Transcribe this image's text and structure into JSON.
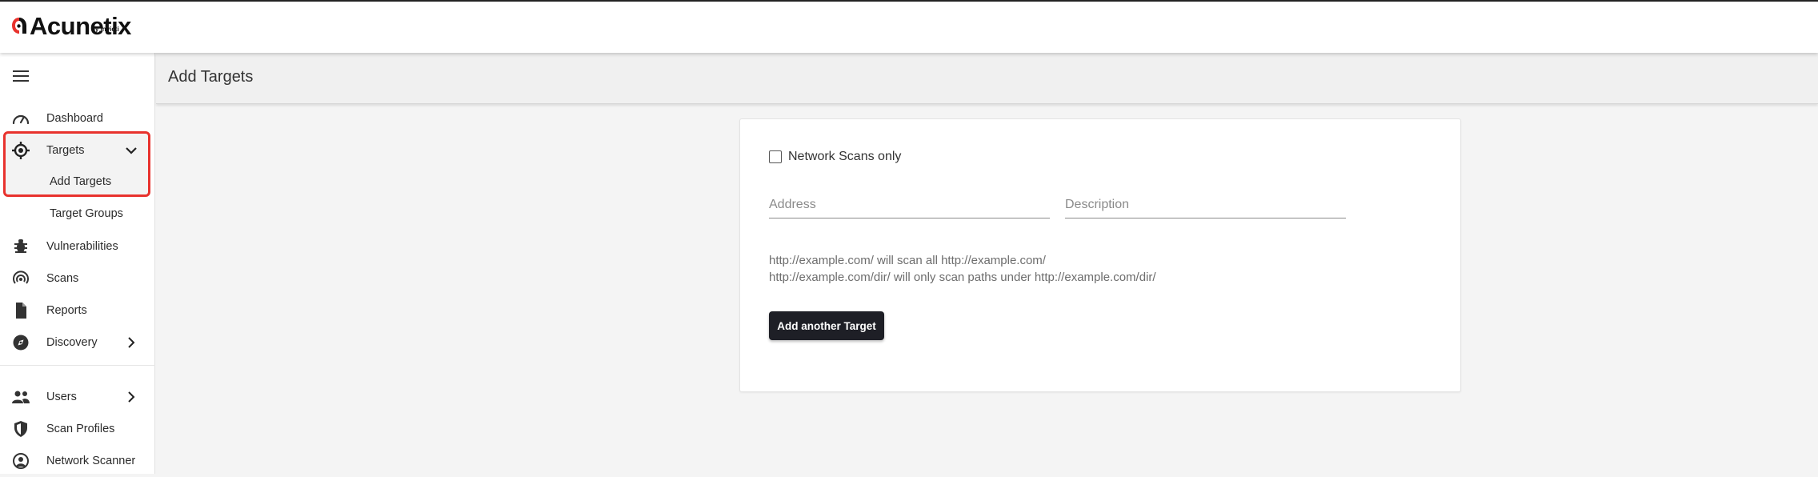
{
  "app": {
    "brand": "Acunetix",
    "brand_by": "by Invicti"
  },
  "sidebar": {
    "items": [
      {
        "label": "Dashboard",
        "icon": "dashboard-gauge-icon"
      },
      {
        "label": "Targets",
        "icon": "target-crosshair-icon",
        "expanded": true
      },
      {
        "label": "Add Targets",
        "sub": true,
        "selected": true
      },
      {
        "label": "Target Groups",
        "sub": true
      },
      {
        "label": "Vulnerabilities",
        "icon": "bug-icon"
      },
      {
        "label": "Scans",
        "icon": "radar-icon"
      },
      {
        "label": "Reports",
        "icon": "document-icon"
      },
      {
        "label": "Discovery",
        "icon": "compass-icon"
      },
      {
        "label": "Users",
        "icon": "users-icon"
      },
      {
        "label": "Scan Profiles",
        "icon": "shield-icon"
      },
      {
        "label": "Network Scanner",
        "icon": "network-scanner-icon"
      }
    ]
  },
  "page": {
    "title": "Add Targets"
  },
  "form": {
    "network_only_label": "Network Scans only",
    "network_only_checked": false,
    "address_placeholder": "Address",
    "address_value": "",
    "description_placeholder": "Description",
    "description_value": "",
    "hint_line_1": "http://example.com/ will scan all http://example.com/",
    "hint_line_2": "http://example.com/dir/ will only scan paths under http://example.com/dir/",
    "add_button_label": "Add another Target"
  },
  "colors": {
    "highlight_border": "#e8322d",
    "button_bg": "#1e1f26",
    "logo_accent": "#e8322d"
  }
}
